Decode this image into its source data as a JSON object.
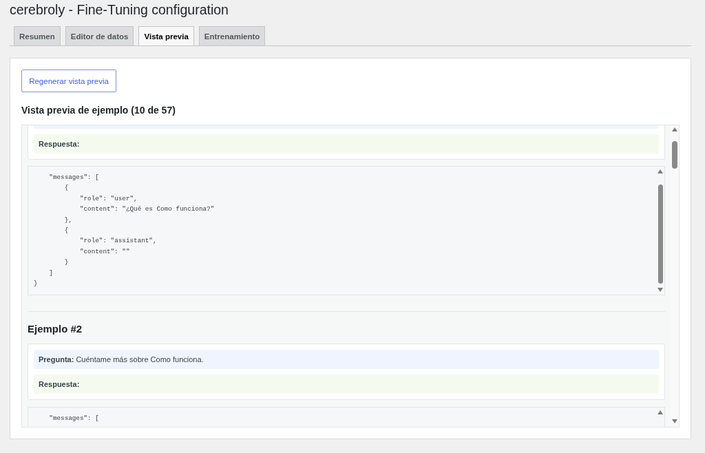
{
  "page": {
    "title": "cerebroly - Fine-Tuning configuration"
  },
  "tabs": [
    {
      "label": "Resumen",
      "selected": false
    },
    {
      "label": "Editor de datos",
      "selected": false
    },
    {
      "label": "Vista previa",
      "selected": true
    },
    {
      "label": "Entrenamiento",
      "selected": false
    }
  ],
  "panel": {
    "regenerate_button": "Regenerar vista previa",
    "heading": "Vista previa de ejemplo (10 de 57)",
    "examples": [
      {
        "card_cut_top": true,
        "answer_label": "Respuesta:",
        "code_cut_bottom": false,
        "code_lines": [
          "    \"messages\": [",
          "        {",
          "            \"role\": \"user\",",
          "            \"content\": \"¿Qué es Como funciona?\"",
          "        },",
          "        {",
          "            \"role\": \"assistant\",",
          "            \"content\": \"\"",
          "        }",
          "    ]",
          "}"
        ]
      },
      {
        "heading": "Ejemplo #2",
        "card_cut_top": false,
        "question": "**Pregunta:** Cuéntame más sobre Como funciona.",
        "answer_label": "Respuesta:",
        "code_cut_bottom": true,
        "code_lines": [
          "    \"messages\": ["
        ]
      }
    ]
  }
}
